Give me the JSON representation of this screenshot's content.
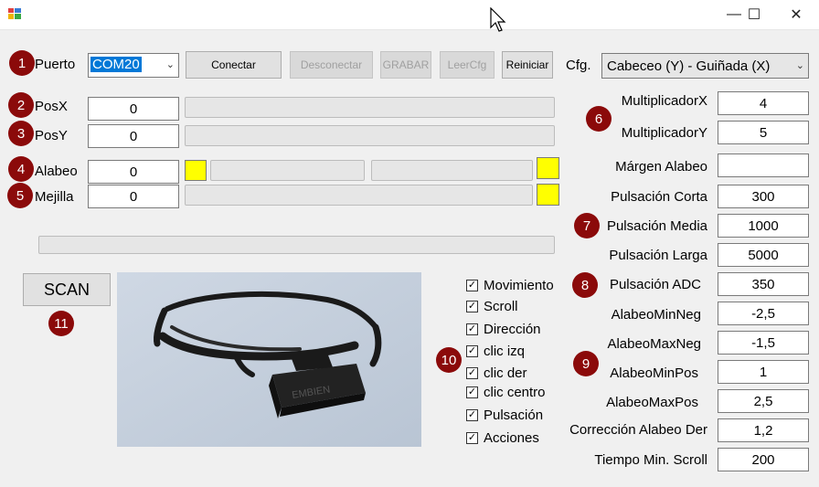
{
  "window": {
    "minimize_glyph": "—",
    "maximize_glyph": "☐",
    "close_glyph": "✕"
  },
  "badges": [
    "1",
    "2",
    "3",
    "4",
    "5",
    "6",
    "7",
    "8",
    "9",
    "10",
    "11"
  ],
  "top": {
    "port_label": "Puerto",
    "port_value": "COM20",
    "buttons": {
      "connect": "Conectar",
      "disconnect": "Desconectar",
      "record": "GRABAR",
      "readcfg": "LeerCfg",
      "restart": "Reiniciar"
    },
    "cfg_label": "Cfg.",
    "cfg_value": "Cabeceo (Y) - Guiñada (X)"
  },
  "left_rows": {
    "posx": {
      "label": "PosX",
      "value": "0"
    },
    "posy": {
      "label": "PosY",
      "value": "0"
    },
    "alabeo": {
      "label": "Alabeo",
      "value": "0"
    },
    "mejilla": {
      "label": "Mejilla",
      "value": "0"
    }
  },
  "scan_label": "SCAN",
  "checkboxes": [
    "Movimiento",
    "Scroll",
    "Dirección",
    "clic izq",
    "clic der",
    "clic centro",
    "Pulsación",
    "Acciones"
  ],
  "check_mark": "✓",
  "settings": [
    {
      "label": "MultiplicadorX",
      "value": "4"
    },
    {
      "label": "MultiplicadorY",
      "value": "5"
    },
    {
      "label": "Márgen Alabeo",
      "value": ""
    },
    {
      "label": "Pulsación Corta",
      "value": "300"
    },
    {
      "label": "Pulsación Media",
      "value": "1000"
    },
    {
      "label": "Pulsación Larga",
      "value": "5000"
    },
    {
      "label": "Pulsación ADC",
      "value": "350"
    },
    {
      "label": "AlabeoMinNeg",
      "value": "-2,5"
    },
    {
      "label": "AlabeoMaxNeg",
      "value": "-1,5"
    },
    {
      "label": "AlabeoMinPos",
      "value": "1"
    },
    {
      "label": "AlabeoMaxPos",
      "value": "2,5"
    },
    {
      "label": "Corrección Alabeo Der",
      "value": "1,2"
    },
    {
      "label": "Tiempo Min. Scroll",
      "value": "200"
    }
  ],
  "device_image_text": "EMBIEN"
}
